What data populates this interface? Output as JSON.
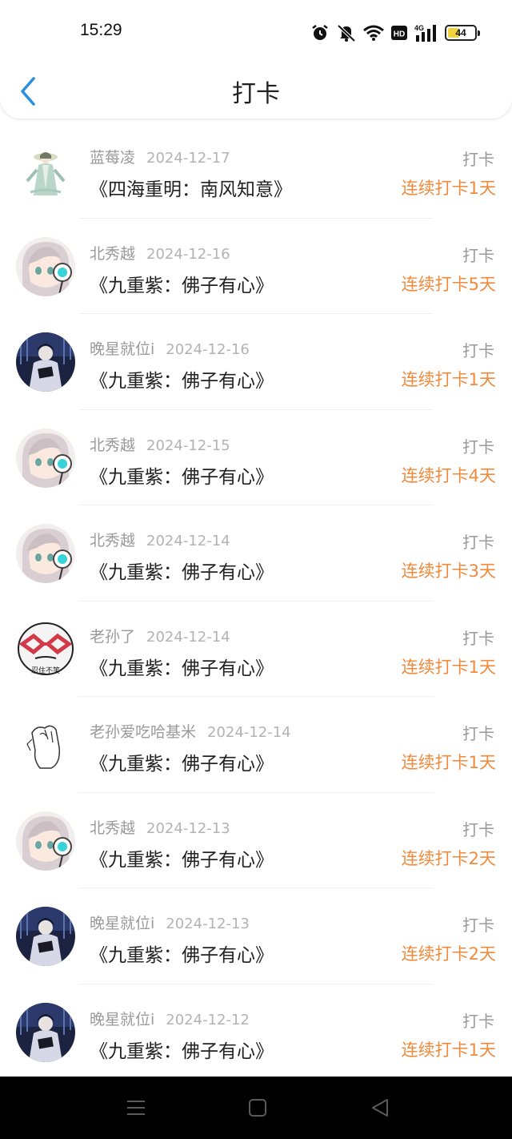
{
  "status_bar": {
    "time": "15:29",
    "network": "4G",
    "hd": "HD",
    "battery": "44",
    "battery_level": 0.44,
    "battery_color": "#f2d33c"
  },
  "header": {
    "title": "打卡"
  },
  "colors": {
    "accent": "#f08a3c",
    "back": "#2a8fe0",
    "muted": "#9a9a9a"
  },
  "records": [
    {
      "user": "蓝莓凌",
      "date": "2024-12-17",
      "book": "《四海重明：南风知意》",
      "tag": "打卡",
      "streak": "连续打卡1天",
      "avatar": "ancient-figure"
    },
    {
      "user": "北秀越",
      "date": "2024-12-16",
      "book": "《九重紫：佛子有心》",
      "tag": "打卡",
      "streak": "连续打卡5天",
      "avatar": "anime-headphones"
    },
    {
      "user": "晚星就位i",
      "date": "2024-12-16",
      "book": "《九重紫：佛子有心》",
      "tag": "打卡",
      "streak": "连续打卡1天",
      "avatar": "dark-reader"
    },
    {
      "user": "北秀越",
      "date": "2024-12-15",
      "book": "《九重紫：佛子有心》",
      "tag": "打卡",
      "streak": "连续打卡4天",
      "avatar": "anime-headphones"
    },
    {
      "user": "北秀越",
      "date": "2024-12-14",
      "book": "《九重紫：佛子有心》",
      "tag": "打卡",
      "streak": "连续打卡3天",
      "avatar": "anime-headphones"
    },
    {
      "user": "老孙了",
      "date": "2024-12-14",
      "book": "《九重紫：佛子有心》",
      "tag": "打卡",
      "streak": "连续打卡1天",
      "avatar": "meme-glasses",
      "avatar_caption": "忍住不笑"
    },
    {
      "user": "老孙爱吃哈基米",
      "date": "2024-12-14",
      "book": "《九重紫：佛子有心》",
      "tag": "打卡",
      "streak": "连续打卡1天",
      "avatar": "sketch-hand"
    },
    {
      "user": "北秀越",
      "date": "2024-12-13",
      "book": "《九重紫：佛子有心》",
      "tag": "打卡",
      "streak": "连续打卡2天",
      "avatar": "anime-headphones"
    },
    {
      "user": "晚星就位i",
      "date": "2024-12-13",
      "book": "《九重紫：佛子有心》",
      "tag": "打卡",
      "streak": "连续打卡2天",
      "avatar": "dark-reader"
    },
    {
      "user": "晚星就位i",
      "date": "2024-12-12",
      "book": "《九重紫：佛子有心》",
      "tag": "打卡",
      "streak": "连续打卡1天",
      "avatar": "dark-reader"
    }
  ]
}
